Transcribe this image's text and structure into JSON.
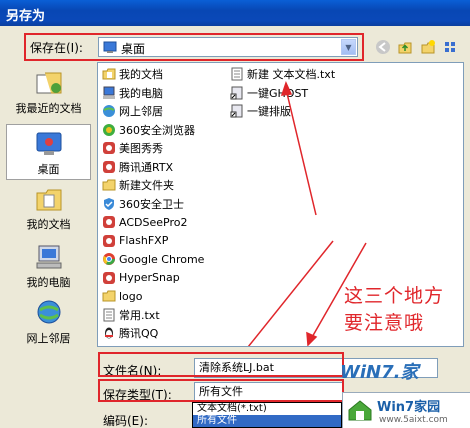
{
  "dialog": {
    "title": "另存为"
  },
  "save_in": {
    "label": "保存在(I):",
    "value": "桌面"
  },
  "places": [
    {
      "label": "我最近的文档",
      "icon": "recent-documents-icon"
    },
    {
      "label": "桌面",
      "icon": "desktop-icon"
    },
    {
      "label": "我的文档",
      "icon": "my-documents-icon"
    },
    {
      "label": "我的电脑",
      "icon": "my-computer-icon"
    },
    {
      "label": "网上邻居",
      "icon": "network-places-icon"
    }
  ],
  "files": [
    {
      "name": "我的文档",
      "icon": "my-documents-icon"
    },
    {
      "name": "我的电脑",
      "icon": "my-computer-icon"
    },
    {
      "name": "网上邻居",
      "icon": "network-places-icon"
    },
    {
      "name": "360安全浏览器",
      "icon": "browser-icon"
    },
    {
      "name": "美图秀秀",
      "icon": "app-icon"
    },
    {
      "name": "腾讯通RTX",
      "icon": "app-icon"
    },
    {
      "name": "新建文件夹",
      "icon": "folder-icon"
    },
    {
      "name": "360安全卫士",
      "icon": "shield-icon"
    },
    {
      "name": "ACDSeePro2",
      "icon": "app-icon"
    },
    {
      "name": "FlashFXP",
      "icon": "app-icon"
    },
    {
      "name": "Google Chrome",
      "icon": "chrome-icon"
    },
    {
      "name": "HyperSnap",
      "icon": "app-icon"
    },
    {
      "name": "logo",
      "icon": "folder-icon"
    },
    {
      "name": "常用.txt",
      "icon": "text-file-icon"
    },
    {
      "name": "腾讯QQ",
      "icon": "qq-icon"
    },
    {
      "name": "新建 文本文档.txt",
      "icon": "text-file-icon"
    },
    {
      "name": "一键GHOST",
      "icon": "shortcut-icon"
    },
    {
      "name": "一键排版",
      "icon": "shortcut-icon"
    }
  ],
  "annotation": "这三个地方要注意哦",
  "filename": {
    "label": "文件名(N):",
    "value": "清除系统LJ.bat"
  },
  "save_type": {
    "label": "保存类型(T):",
    "value": "所有文件"
  },
  "encoding": {
    "label": "编码(E):"
  },
  "type_options": [
    "文本文档(*.txt)",
    "所有文件"
  ],
  "watermark": {
    "brand": "WiN7.家",
    "site_name": "Win7家园",
    "url": "www.5aixt.com"
  },
  "colors": {
    "annotation": "#e0262b",
    "title_bar": "#0a5fd6",
    "selection": "#316ac5"
  }
}
